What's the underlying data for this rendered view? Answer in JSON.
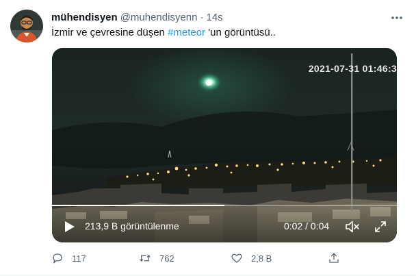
{
  "author": {
    "display_name": "mühendisyen",
    "handle": "@muhendisyenn",
    "separator": "·",
    "time": "14s"
  },
  "tweet": {
    "text_before": "İzmir ve çevresine düşen ",
    "hashtag": "#meteor",
    "text_after": " 'un görüntüsü.."
  },
  "media": {
    "timestamp_overlay": "2021-07-31 01:46:3",
    "views": "213,9 B görüntülenme",
    "duration": "0:02 / 0:04",
    "progress": 0.5
  },
  "actions": {
    "reply_count": "117",
    "retweet_count": "762",
    "like_count": "2,8 B",
    "share_count": ""
  },
  "icons": {
    "more": "more-horizontal-icon",
    "reply": "reply-icon",
    "retweet": "retweet-icon",
    "like": "heart-icon",
    "share": "share-icon",
    "play": "play-icon",
    "mute": "speaker-muted-icon",
    "fullscreen": "fullscreen-icon"
  },
  "colors": {
    "accent": "#1d9bf0",
    "secondary_text": "#536471"
  }
}
